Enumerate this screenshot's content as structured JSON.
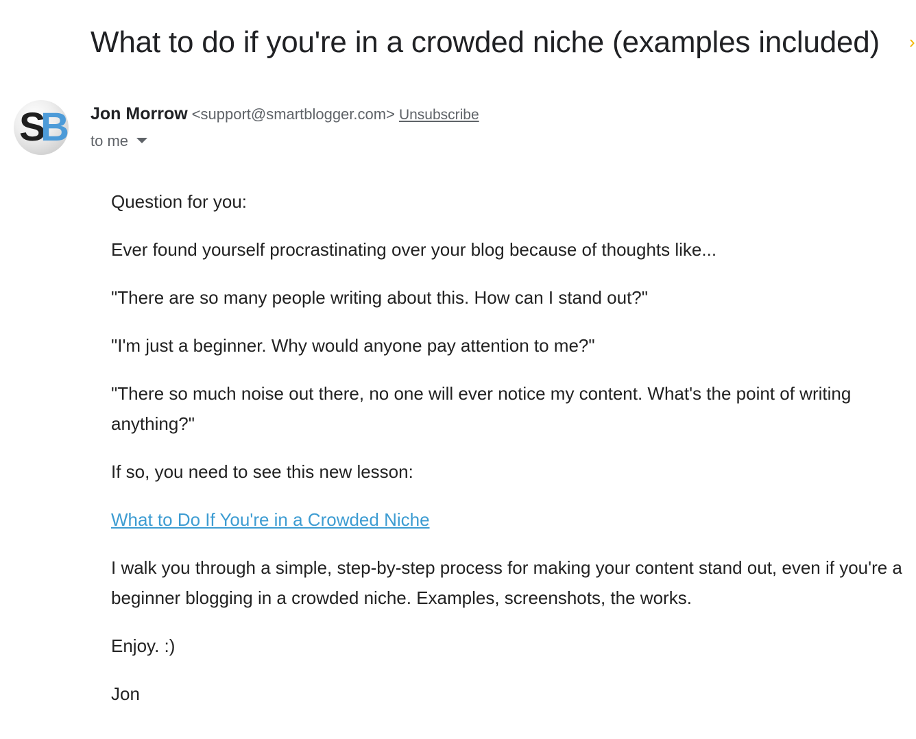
{
  "email": {
    "subject": "What to do if you're in a crowded niche (examples included)",
    "importance_marker": "›",
    "sender": {
      "avatar_letters": [
        "S",
        "B"
      ],
      "name": "Jon Morrow",
      "email": "<support@smartblogger.com>",
      "unsubscribe_label": "Unsubscribe"
    },
    "recipient_label": "to me",
    "body": {
      "p1": "Question for you:",
      "p2": "Ever found yourself procrastinating over your blog because of thoughts like...",
      "p3": "\"There are so many people writing about this. How can I stand out?\"",
      "p4": "\"I'm just a beginner. Why would anyone pay attention to me?\"",
      "p5": "\"There so much noise out there, no one will ever notice my content. What's the point of writing anything?\"",
      "p6": "If so, you need to see this new lesson:",
      "link_text": "What to Do If You're in a Crowded Niche",
      "p8": "I walk you through a simple, step-by-step process for making your content stand out, even if you're a beginner blogging in a crowded niche. Examples, screenshots, the works.",
      "p9": "Enjoy. :)",
      "signature": "Jon"
    }
  },
  "colors": {
    "link": "#3d9cd2",
    "avatar_b": "#4d9bd8",
    "importance": "#f2b400"
  }
}
